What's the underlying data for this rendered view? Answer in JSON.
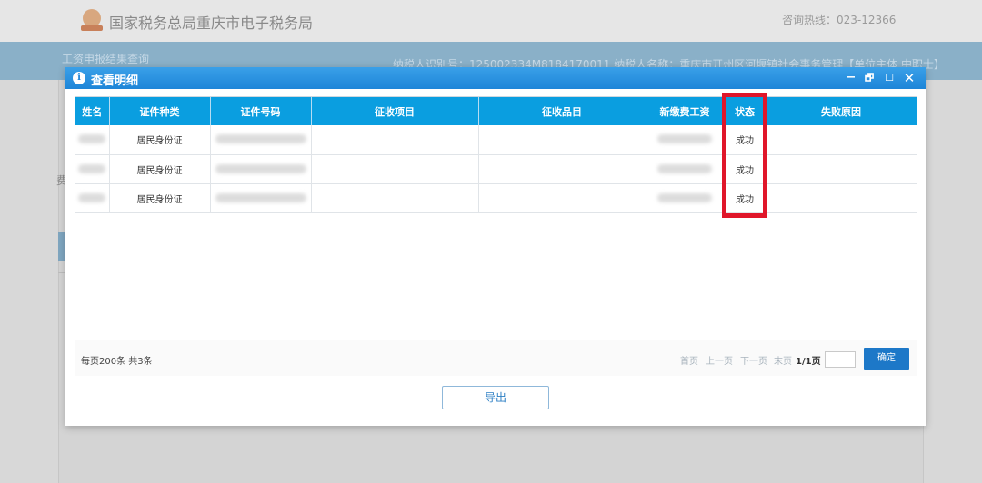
{
  "header": {
    "title": "国家税务总局重庆市电子税务局",
    "hotline": "咨询热线：023-12366"
  },
  "band": {
    "left": "工资申报结果查询",
    "right": "纳税人识别号：125002334M8184170011    纳税人名称：重庆市开州区河堰镇社会事务管理【单位主体 中职士】"
  },
  "side_char": "费",
  "dialog": {
    "title": "查看明细",
    "controls": {
      "minimize": "−",
      "restore": "🗗",
      "maximize": "☐",
      "close": "✕"
    }
  },
  "table": {
    "columns": [
      "姓名",
      "证件种类",
      "证件号码",
      "征收项目",
      "征收品目",
      "新缴费工资",
      "状态",
      "失败原因"
    ],
    "rows": [
      {
        "id_type": "居民身份证",
        "status": "成功",
        "reason": ""
      },
      {
        "id_type": "居民身份证",
        "status": "成功",
        "reason": ""
      },
      {
        "id_type": "居民身份证",
        "status": "成功",
        "reason": ""
      }
    ]
  },
  "pager": {
    "info": "每页200条 共3条",
    "first": "首页",
    "prev": "上一页",
    "next": "下一页",
    "last": "末页",
    "count": "1/1页",
    "confirm": "确定"
  },
  "export_label": "导出",
  "colors": {
    "accent": "#0a9ee0",
    "highlight": "#e0162a",
    "confirm": "#1d78c8"
  }
}
